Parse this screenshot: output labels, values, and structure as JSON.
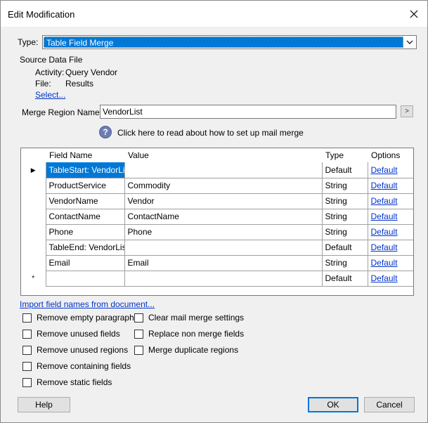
{
  "window": {
    "title": "Edit Modification"
  },
  "type_field": {
    "label": "Type:",
    "value": "Table Field Merge"
  },
  "source": {
    "heading": "Source Data File",
    "activity_label": "Activity:",
    "activity_value": "Query Vendor",
    "file_label": "File:",
    "file_value": "Results",
    "select_link": "Select..."
  },
  "merge_region": {
    "label": "Merge Region Name:",
    "value": "VendorList",
    "browse_button": ">"
  },
  "help_link": {
    "icon": "?",
    "text": "Click here to read about how to set up mail merge"
  },
  "grid": {
    "columns": [
      "Field Name",
      "Value",
      "Type",
      "Options"
    ],
    "rows": [
      {
        "marker": "▶",
        "field": "TableStart: VendorList",
        "value": "",
        "type": "Default",
        "option": "Default"
      },
      {
        "marker": "",
        "field": "ProductService",
        "value": "Commodity",
        "type": "String",
        "option": "Default"
      },
      {
        "marker": "",
        "field": "VendorName",
        "value": "Vendor",
        "type": "String",
        "option": "Default"
      },
      {
        "marker": "",
        "field": "ContactName",
        "value": "ContactName",
        "type": "String",
        "option": "Default"
      },
      {
        "marker": "",
        "field": "Phone",
        "value": "Phone",
        "type": "String",
        "option": "Default"
      },
      {
        "marker": "",
        "field": "TableEnd: VendorList",
        "value": "",
        "type": "Default",
        "option": "Default"
      },
      {
        "marker": "",
        "field": "Email",
        "value": "Email",
        "type": "String",
        "option": "Default"
      },
      {
        "marker": "*",
        "field": "",
        "value": "",
        "type": "Default",
        "option": "Default"
      }
    ]
  },
  "import_link": "Import field names from document...",
  "options_left": [
    {
      "label": "Remove empty paragraphs",
      "checked": false
    },
    {
      "label": "Remove unused fields",
      "checked": false
    },
    {
      "label": "Remove unused regions",
      "checked": false
    },
    {
      "label": "Remove containing fields",
      "checked": false
    },
    {
      "label": "Remove static fields",
      "checked": false
    }
  ],
  "options_right": [
    {
      "label": "Clear mail merge settings",
      "checked": false
    },
    {
      "label": "Replace non merge fields",
      "checked": false
    },
    {
      "label": "Merge duplicate regions",
      "checked": false
    }
  ],
  "buttons": {
    "help": "Help",
    "ok": "OK",
    "cancel": "Cancel"
  },
  "colors": {
    "selection": "#0078d7",
    "link": "#0033cc",
    "dialog_bg": "#f0f0f0"
  }
}
